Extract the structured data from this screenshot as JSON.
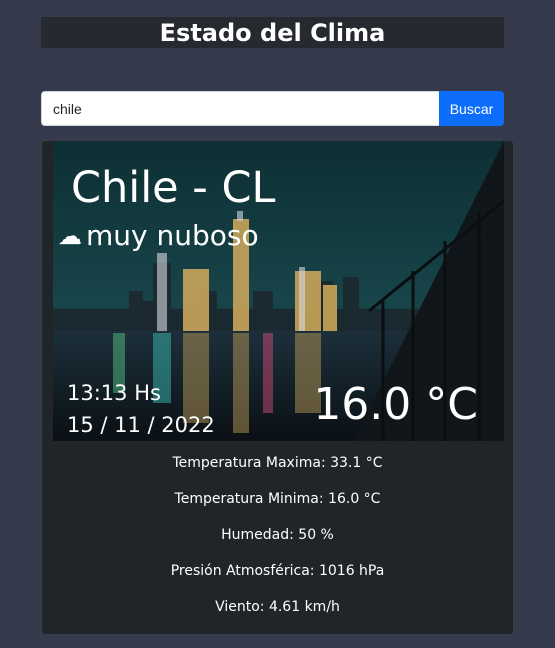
{
  "header": {
    "title": "Estado del Clima"
  },
  "search": {
    "value": "chile",
    "button_label": "Buscar"
  },
  "weather": {
    "city": "Chile - CL",
    "condition_icon": "cloud-icon",
    "condition": "muy nuboso",
    "time": "13:13 Hs",
    "date": "15 / 11 / 2022",
    "temperature": "16.0 °C"
  },
  "details": {
    "max": "Temperatura Maxima: 33.1 °C",
    "min": "Temperatura Minima: 16.0 °C",
    "humidity": "Humedad: 50 %",
    "pressure": "Presión Atmosférica: 1016 hPa",
    "wind": "Viento: 4.61 km/h"
  },
  "colors": {
    "page_bg": "#353a4d",
    "card_bg": "#212529",
    "button_bg": "#0d6efd"
  }
}
